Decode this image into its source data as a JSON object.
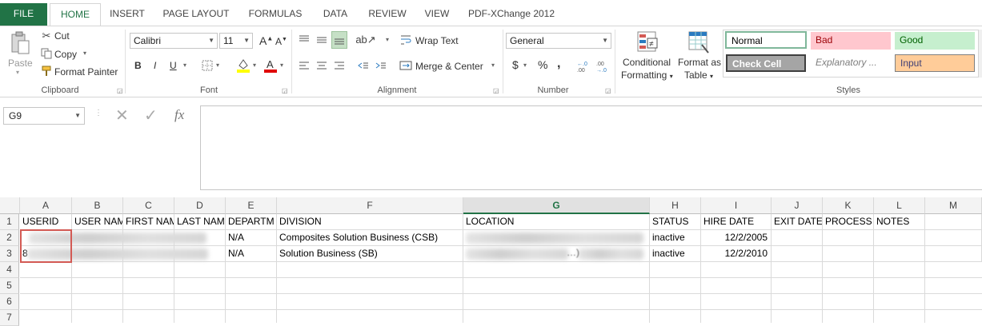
{
  "tabs": {
    "file": "FILE",
    "items": [
      "HOME",
      "INSERT",
      "PAGE LAYOUT",
      "FORMULAS",
      "DATA",
      "REVIEW",
      "VIEW",
      "PDF-XChange 2012"
    ]
  },
  "ribbon": {
    "clipboard": {
      "paste": "Paste",
      "cut": "Cut",
      "copy": "Copy",
      "format_painter": "Format Painter",
      "label": "Clipboard"
    },
    "font": {
      "name": "Calibri",
      "size": "11",
      "bold": "B",
      "italic": "I",
      "underline": "U",
      "grow": "A",
      "shrink": "A",
      "label": "Font"
    },
    "alignment": {
      "wrap_text": "Wrap Text",
      "merge_center": "Merge & Center",
      "label": "Alignment"
    },
    "number": {
      "format": "General",
      "currency": "$",
      "percent": "%",
      "comma": ",",
      "label": "Number"
    },
    "styles": {
      "conditional_formatting_1": "Conditional",
      "conditional_formatting_2": "Formatting",
      "format_table_1": "Format as",
      "format_table_2": "Table",
      "normal": "Normal",
      "bad": "Bad",
      "good": "Good",
      "check_cell": "Check Cell",
      "explanatory": "Explanatory ...",
      "input": "Input",
      "label": "Styles"
    },
    "colors": {
      "accent": "#217346",
      "bad_bg": "#ffc7ce",
      "bad_fg": "#9c0006",
      "good_bg": "#c6efce",
      "good_fg": "#006100",
      "input_bg": "#ffcc99",
      "check_bg": "#a5a5a5"
    }
  },
  "formula_bar": {
    "name_box": "G9",
    "fx": "fx",
    "value": ""
  },
  "sheet": {
    "columns": [
      "A",
      "B",
      "C",
      "D",
      "E",
      "F",
      "G",
      "H",
      "I",
      "J",
      "K",
      "L",
      "M"
    ],
    "selected_column": "G",
    "row_numbers": [
      "1",
      "2",
      "3",
      "4",
      "5",
      "6",
      "7"
    ],
    "header_row": [
      "USERID",
      "USER NAM",
      "FIRST NAM",
      "LAST NAM",
      "DEPARTM",
      "DIVISION",
      "LOCATION",
      "STATUS",
      "HIRE DATE",
      "EXIT DATE",
      "PROCESS S",
      "NOTES",
      ""
    ],
    "rows": [
      {
        "dept": "N/A",
        "division": "Composites Solution Business (CSB)",
        "status": "inactive",
        "hire": "12/2/2005"
      },
      {
        "userid_frag": "8",
        "dept": "N/A",
        "division": "Solution Business (SB)",
        "status": "inactive",
        "hire": "12/2/2010",
        "location_frag": "…)"
      }
    ]
  }
}
